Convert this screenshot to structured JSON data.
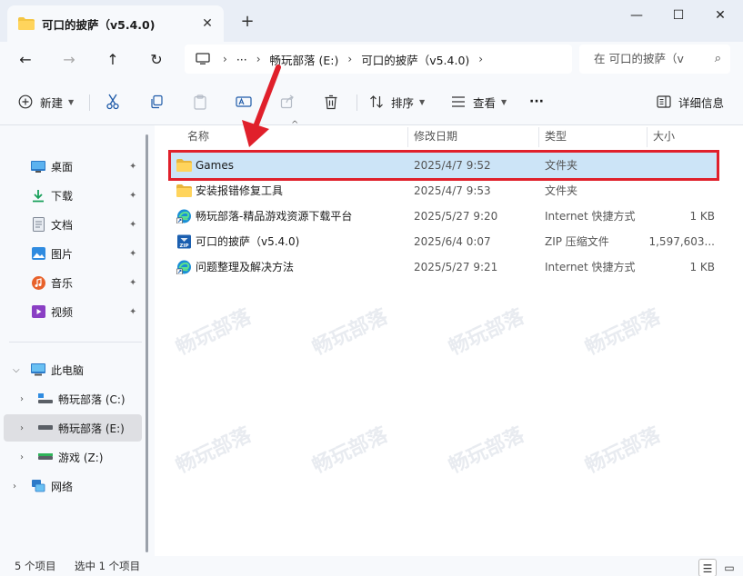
{
  "window": {
    "tab_title": "可口的披萨（v5.4.0)",
    "tab_close": "✕",
    "new_tab": "+",
    "controls": [
      "—",
      "☐",
      "✕"
    ]
  },
  "nav": {
    "back": "←",
    "forward": "→",
    "up": "↑",
    "refresh": "↻"
  },
  "address": {
    "pc_icon": "computer-icon",
    "ellipsis": "···",
    "sep": "›",
    "crumbs": [
      "畅玩部落 (E:)",
      "可口的披萨（v5.4.0)"
    ],
    "search_placeholder": "在 可口的披萨（v",
    "search_icon": "⌕"
  },
  "commands": {
    "new": "新建",
    "sort": "排序",
    "view": "查看",
    "more": "···",
    "details": "详细信息"
  },
  "sidebar": {
    "quick": [
      {
        "label": "桌面",
        "icon": "desktop-icon"
      },
      {
        "label": "下载",
        "icon": "download-icon"
      },
      {
        "label": "文档",
        "icon": "document-icon"
      },
      {
        "label": "图片",
        "icon": "pictures-icon"
      },
      {
        "label": "音乐",
        "icon": "music-icon"
      },
      {
        "label": "视频",
        "icon": "video-icon"
      }
    ],
    "pin": "📌",
    "this_pc": "此电脑",
    "drives": [
      {
        "label": "畅玩部落 (C:)"
      },
      {
        "label": "畅玩部落 (E:)"
      },
      {
        "label": "游戏 (Z:)"
      }
    ],
    "network": "网络"
  },
  "columns": {
    "name": "名称",
    "date": "修改日期",
    "type": "类型",
    "size": "大小",
    "sort_arrow": "^"
  },
  "files": [
    {
      "name": "Games",
      "date": "2025/4/7 9:52",
      "type": "文件夹",
      "size": "",
      "icon": "folder-icon",
      "selected": true
    },
    {
      "name": "安装报错修复工具",
      "date": "2025/4/7 9:53",
      "type": "文件夹",
      "size": "",
      "icon": "folder-icon",
      "selected": false
    },
    {
      "name": "畅玩部落-精品游戏资源下载平台",
      "date": "2025/5/27 9:20",
      "type": "Internet 快捷方式",
      "size": "1 KB",
      "icon": "edge-shortcut-icon",
      "selected": false
    },
    {
      "name": "可口的披萨（v5.4.0)",
      "date": "2025/6/4 0:07",
      "type": "ZIP 压缩文件",
      "size": "1,597,603...",
      "icon": "zip-icon",
      "selected": false
    },
    {
      "name": "问题整理及解决方法",
      "date": "2025/5/27 9:21",
      "type": "Internet 快捷方式",
      "size": "1 KB",
      "icon": "edge-shortcut-icon",
      "selected": false
    }
  ],
  "status": {
    "count": "5 个项目",
    "selected": "选中 1 个项目"
  },
  "watermark": "畅玩部落",
  "colors": {
    "accent": "#0067c0",
    "selection": "#cce4f7",
    "annotation": "#e0202b",
    "folder": "#f4c542"
  }
}
